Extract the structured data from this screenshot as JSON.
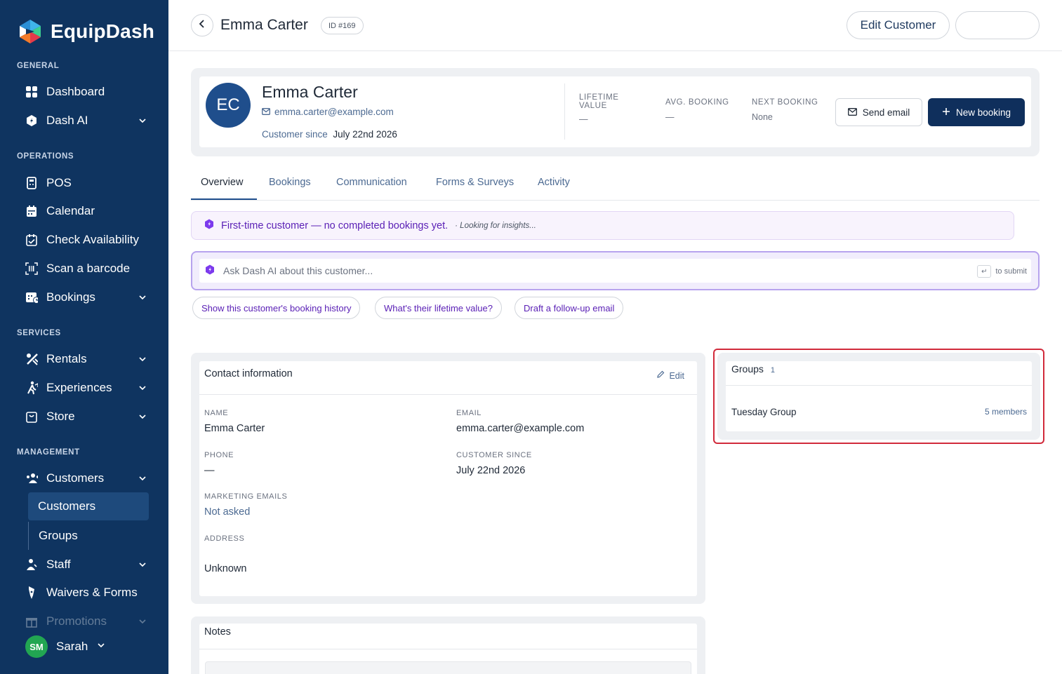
{
  "app": {
    "name": "EquipDash"
  },
  "sidebar": {
    "sections": [
      "GENERAL",
      "OPERATIONS",
      "SERVICES",
      "MANAGEMENT"
    ],
    "items": [
      {
        "label": "Dashboard",
        "icon": "grid-icon"
      },
      {
        "label": "Dash AI",
        "icon": "ai-hex-icon"
      },
      {
        "label": "POS",
        "icon": "pos-terminal-icon"
      },
      {
        "label": "Calendar",
        "icon": "calendar-icon"
      },
      {
        "label": "Check Availability",
        "icon": "calendar-check-icon"
      },
      {
        "label": "Scan a barcode",
        "icon": "barcode-scan-icon"
      },
      {
        "label": "Bookings",
        "icon": "bookings-icon"
      },
      {
        "label": "Rentals",
        "icon": "rentals-icon"
      },
      {
        "label": "Experiences",
        "icon": "experiences-icon"
      },
      {
        "label": "Store",
        "icon": "store-icon"
      },
      {
        "label": "Customers",
        "icon": "users-icon"
      },
      {
        "label": "Staff",
        "icon": "staff-icon"
      },
      {
        "label": "Waivers & Forms",
        "icon": "pen-icon"
      },
      {
        "label": "Promotions",
        "icon": "gift-icon"
      }
    ],
    "sub_items": [
      {
        "label": "Customers",
        "active": true
      },
      {
        "label": "Groups",
        "active": false
      }
    ],
    "user": {
      "initials": "SM",
      "name": "Sarah",
      "avatar_color": "#22a652"
    }
  },
  "header": {
    "title": "Emma Carter",
    "id_badge": "ID #169",
    "edit_button": "Edit Customer"
  },
  "profile": {
    "initials": "EC",
    "name": "Emma Carter",
    "email": "emma.carter@example.com",
    "since_label": "Customer since",
    "since_value": "July 22nd 2026",
    "stats": [
      {
        "label_line1": "LIFETIME",
        "label_line2": "VALUE",
        "value": "—"
      },
      {
        "label_line1": "AVG. BOOKING",
        "label_line2": "",
        "value": "—"
      },
      {
        "label_line1": "NEXT BOOKING",
        "label_line2": "",
        "value": "None"
      }
    ],
    "send_email": "Send email",
    "new_booking": "New booking"
  },
  "tabs": [
    "Overview",
    "Bookings",
    "Communication",
    "Forms & Surveys",
    "Activity"
  ],
  "insight": {
    "text": "First-time customer — no completed bookings yet.",
    "sub": "· Looking for insights..."
  },
  "ask": {
    "placeholder": "Ask Dash AI about this customer...",
    "hint": "to submit"
  },
  "suggestions": [
    "Show this customer's booking history",
    "What's their lifetime value?",
    "Draft a follow-up email"
  ],
  "contact": {
    "title": "Contact information",
    "edit": "Edit",
    "name_label": "NAME",
    "name_value": "Emma Carter",
    "email_label": "EMAIL",
    "email_value": "emma.carter@example.com",
    "phone_label": "PHONE",
    "phone_value": "—",
    "since_label": "CUSTOMER SINCE",
    "since_value": "July 22nd 2026",
    "marketing_label": "MARKETING EMAILS",
    "marketing_value": "Not asked",
    "address_label": "ADDRESS",
    "address_value": "Unknown"
  },
  "groups": {
    "title": "Groups",
    "count": "1",
    "items": [
      {
        "name": "Tuesday Group",
        "members": "5 members"
      }
    ]
  },
  "notes": {
    "title": "Notes"
  },
  "colors": {
    "sidebar": "#0f3460",
    "accent": "#0f2f5c",
    "ai_purple": "#5b21b6",
    "highlight": "#d12a3b"
  }
}
